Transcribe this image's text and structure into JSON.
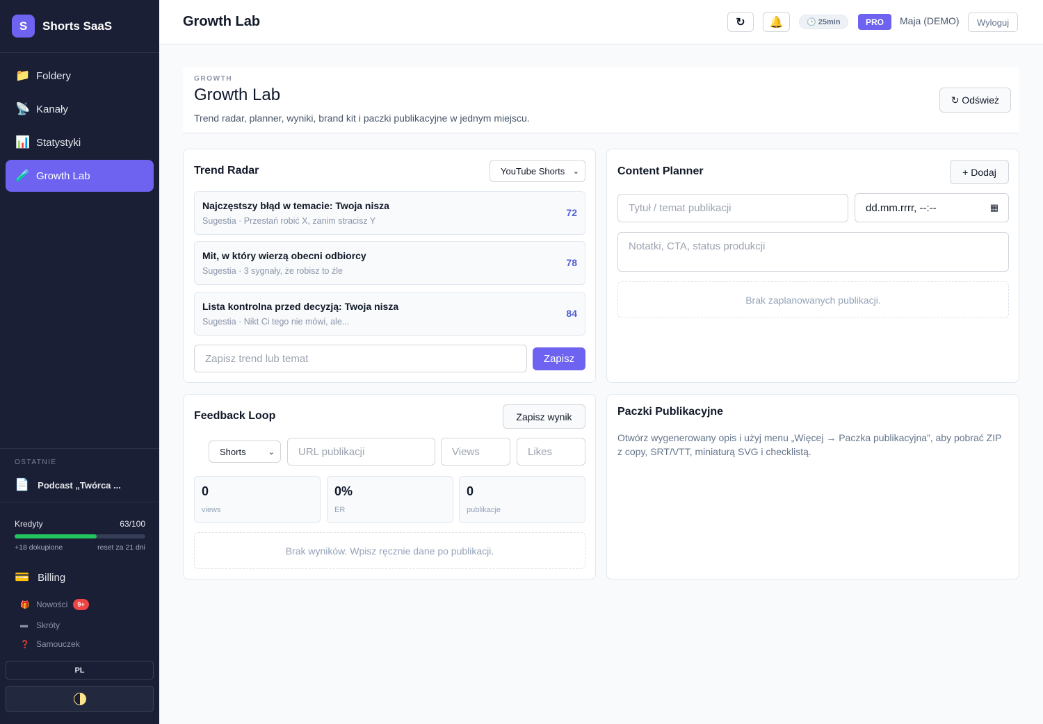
{
  "sidebar": {
    "brand_letter": "S",
    "brand_name": "Shorts SaaS",
    "nav": [
      {
        "icon": "folder-icon",
        "glyph": "📁",
        "label": "Foldery"
      },
      {
        "icon": "satellite-dish-icon",
        "glyph": "📡",
        "label": "Kanały"
      },
      {
        "icon": "bar-chart-icon",
        "glyph": "📊",
        "label": "Statystyki"
      },
      {
        "icon": "test-tube-icon",
        "glyph": "🧪",
        "label": "Growth Lab",
        "active": true
      }
    ],
    "recent_heading": "OSTATNIE",
    "recent_item": "Podcast „Twórca ...",
    "credits": {
      "label": "Kredyty",
      "value": "63/100",
      "fraction": 0.63,
      "bought": "+18 dokupione",
      "reset": "reset za 21 dni"
    },
    "billing": "Billing",
    "news": "Nowości",
    "news_badge": "9+",
    "shortcuts": "Skróty",
    "tutorial": "Samouczek",
    "language": "PL",
    "accent_color": "#6d63f0"
  },
  "topbar": {
    "title": "Growth Lab",
    "refresh_glyph": "↻",
    "bell_glyph": "🔔",
    "timer": "🕒 25min",
    "plan": "PRO",
    "user": "Maja (DEMO)",
    "logout": "Wyloguj"
  },
  "header": {
    "eyebrow": "GROWTH",
    "title": "Growth Lab",
    "description": "Trend radar, planner, wyniki, brand kit i paczki publikacyjne w jednym miejscu.",
    "refresh_label": "↻ Odśwież"
  },
  "trend_radar": {
    "title": "Trend Radar",
    "platform": "YouTube Shorts",
    "items": [
      {
        "title": "Najczęstszy błąd w temacie: Twoja nisza",
        "subtitle": "Sugestia · Przestań robić X, zanim stracisz Y",
        "score": "72"
      },
      {
        "title": "Mit, w który wierzą obecni odbiorcy",
        "subtitle": "Sugestia · 3 sygnały, że robisz to źle",
        "score": "78"
      },
      {
        "title": "Lista kontrolna przed decyzją: Twoja nisza",
        "subtitle": "Sugestia · Nikt Ci tego nie mówi, ale...",
        "score": "84"
      }
    ],
    "input_placeholder": "Zapisz trend lub temat",
    "save_label": "Zapisz"
  },
  "planner": {
    "title": "Content Planner",
    "add_label": "+ Dodaj",
    "title_placeholder": "Tytuł / temat publikacji",
    "date_placeholder": "dd.mm.rrrr, --:--",
    "notes_placeholder": "Notatki, CTA, status produkcji",
    "empty": "Brak zaplanowanych publikacji."
  },
  "feedback": {
    "title": "Feedback Loop",
    "save_label": "Zapisz wynik",
    "format": "Shorts",
    "url_placeholder": "URL publikacji",
    "views_placeholder": "Views",
    "likes_placeholder": "Likes",
    "stats": [
      {
        "value": "0",
        "label": "views"
      },
      {
        "value": "0%",
        "label": "ER"
      },
      {
        "value": "0",
        "label": "publikacje"
      }
    ],
    "empty": "Brak wyników. Wpisz ręcznie dane po publikacji."
  },
  "packs": {
    "title": "Paczki Publikacyjne",
    "description": "Otwórz wygenerowany opis i użyj menu „Więcej → Paczka publikacyjna”, aby pobrać ZIP z copy, SRT/VTT, miniaturą SVG i checklistą."
  }
}
